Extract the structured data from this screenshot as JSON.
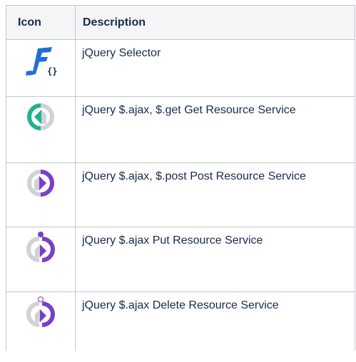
{
  "table": {
    "headers": {
      "icon": "Icon",
      "description": "Description"
    },
    "rows": [
      {
        "icon": "jquery-selector-icon",
        "description": "jQuery Selector",
        "icon_text": "{}"
      },
      {
        "icon": "get-resource-service-icon",
        "description": "jQuery $.ajax, $.get Get Resource Service"
      },
      {
        "icon": "post-resource-service-icon",
        "description": "jQuery $.ajax, $.post Post Resource Service"
      },
      {
        "icon": "put-resource-service-icon",
        "description": "jQuery $.ajax Put Resource Service"
      },
      {
        "icon": "delete-resource-service-icon",
        "description": "jQuery $.ajax Delete Resource Service"
      }
    ]
  },
  "colors": {
    "header_bg": "#f4f5f7",
    "border": "#c1c7d0",
    "text": "#172b4d",
    "selector_blue": "#1f6fd6",
    "get_green": "#1fb393",
    "service_purple": "#7b3fc4",
    "service_gray": "#cfd2d6"
  }
}
